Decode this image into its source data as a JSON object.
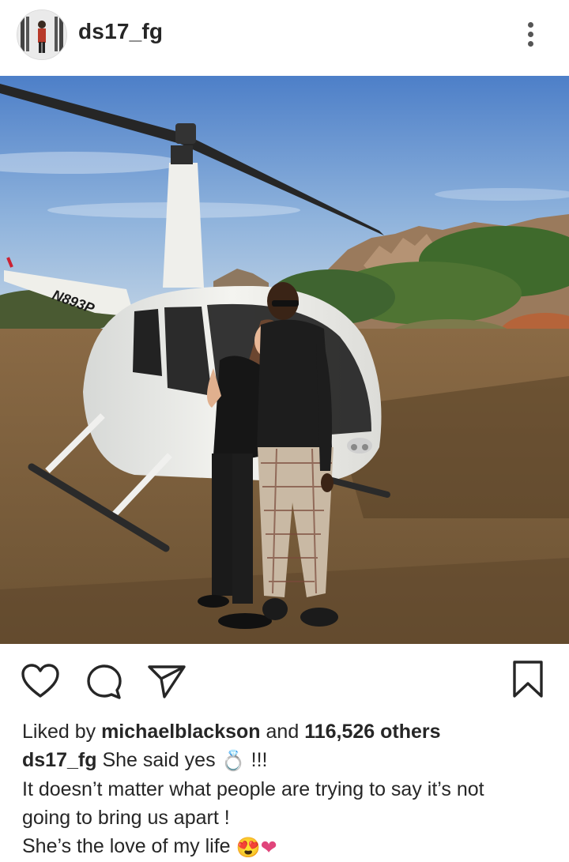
{
  "header": {
    "username": "ds17_fg",
    "avatar_icon": "profile-photo",
    "more_icon": "vertical-ellipsis-icon"
  },
  "post": {
    "image_subject": "helicopter-couple-photo",
    "helicopter_tail_number": "N893P"
  },
  "actions": {
    "like_icon": "heart-icon",
    "comment_icon": "comment-icon",
    "share_icon": "send-icon",
    "save_icon": "bookmark-icon"
  },
  "likes": {
    "prefix": "Liked by",
    "user": "michaelblackson",
    "and": "and",
    "count": "116,526 others"
  },
  "caption": {
    "username": "ds17_fg",
    "text1": "She said yes",
    "ring_emoji": "💍",
    "exclaim": "!!!",
    "line2": "It doesn’t matter what people are trying to say it’s not",
    "line3": "going to bring us apart !",
    "line4": "She’s the love of my life",
    "heart_eyes_emoji": "😍",
    "heart_emoji": "❤"
  },
  "colors": {
    "text": "#262626",
    "icon": "#262626",
    "heart_pink": "#e0457b"
  }
}
